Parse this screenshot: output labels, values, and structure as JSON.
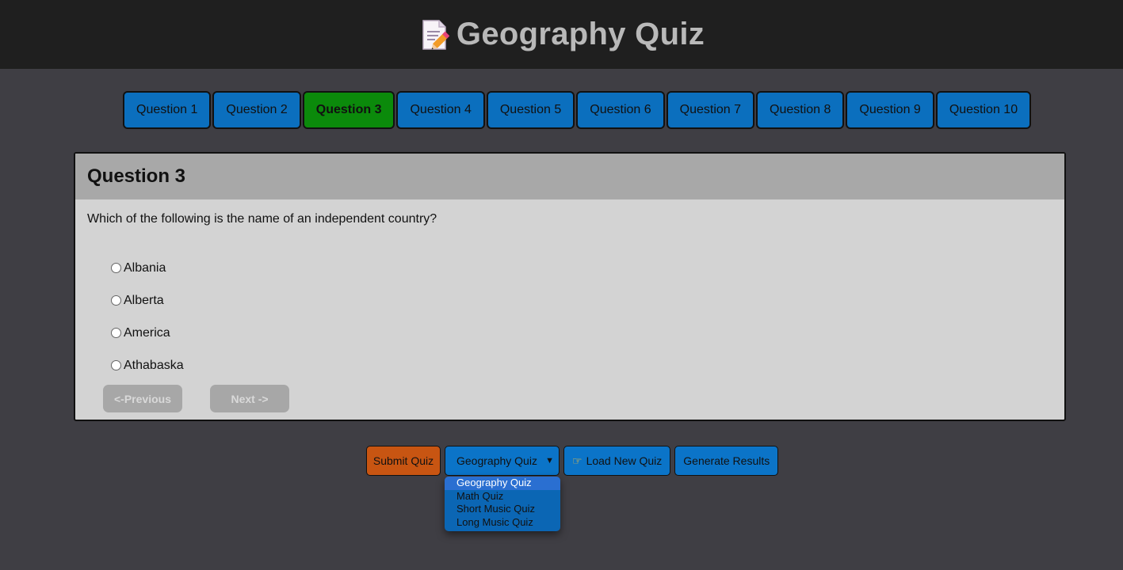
{
  "header": {
    "title": "Geography Quiz",
    "icon": "memo-pencil-icon"
  },
  "nav": {
    "questions": [
      "Question 1",
      "Question 2",
      "Question 3",
      "Question 4",
      "Question 5",
      "Question 6",
      "Question 7",
      "Question 8",
      "Question 9",
      "Question 10"
    ],
    "active_index": 2,
    "colors": {
      "default": "#0b6fbe",
      "active": "#0b8a0b"
    }
  },
  "card": {
    "title": "Question 3",
    "question": "Which of the following is the name of an independent country?",
    "options": [
      "Albania",
      "Alberta",
      "America",
      "Athabaska"
    ],
    "prev_label": "<-Previous",
    "next_label": "Next ->"
  },
  "controls": {
    "submit_label": "Submit Quiz",
    "select_value": "Geography Quiz",
    "load_label": "Load New Quiz",
    "load_icon": "pointing-hand-icon",
    "results_label": "Generate Results",
    "dropdown_options": [
      "Geography Quiz",
      "Math Quiz",
      "Short Music Quiz",
      "Long Music Quiz"
    ],
    "colors": {
      "submit": "#c85512",
      "primary": "#0b74c8"
    }
  }
}
